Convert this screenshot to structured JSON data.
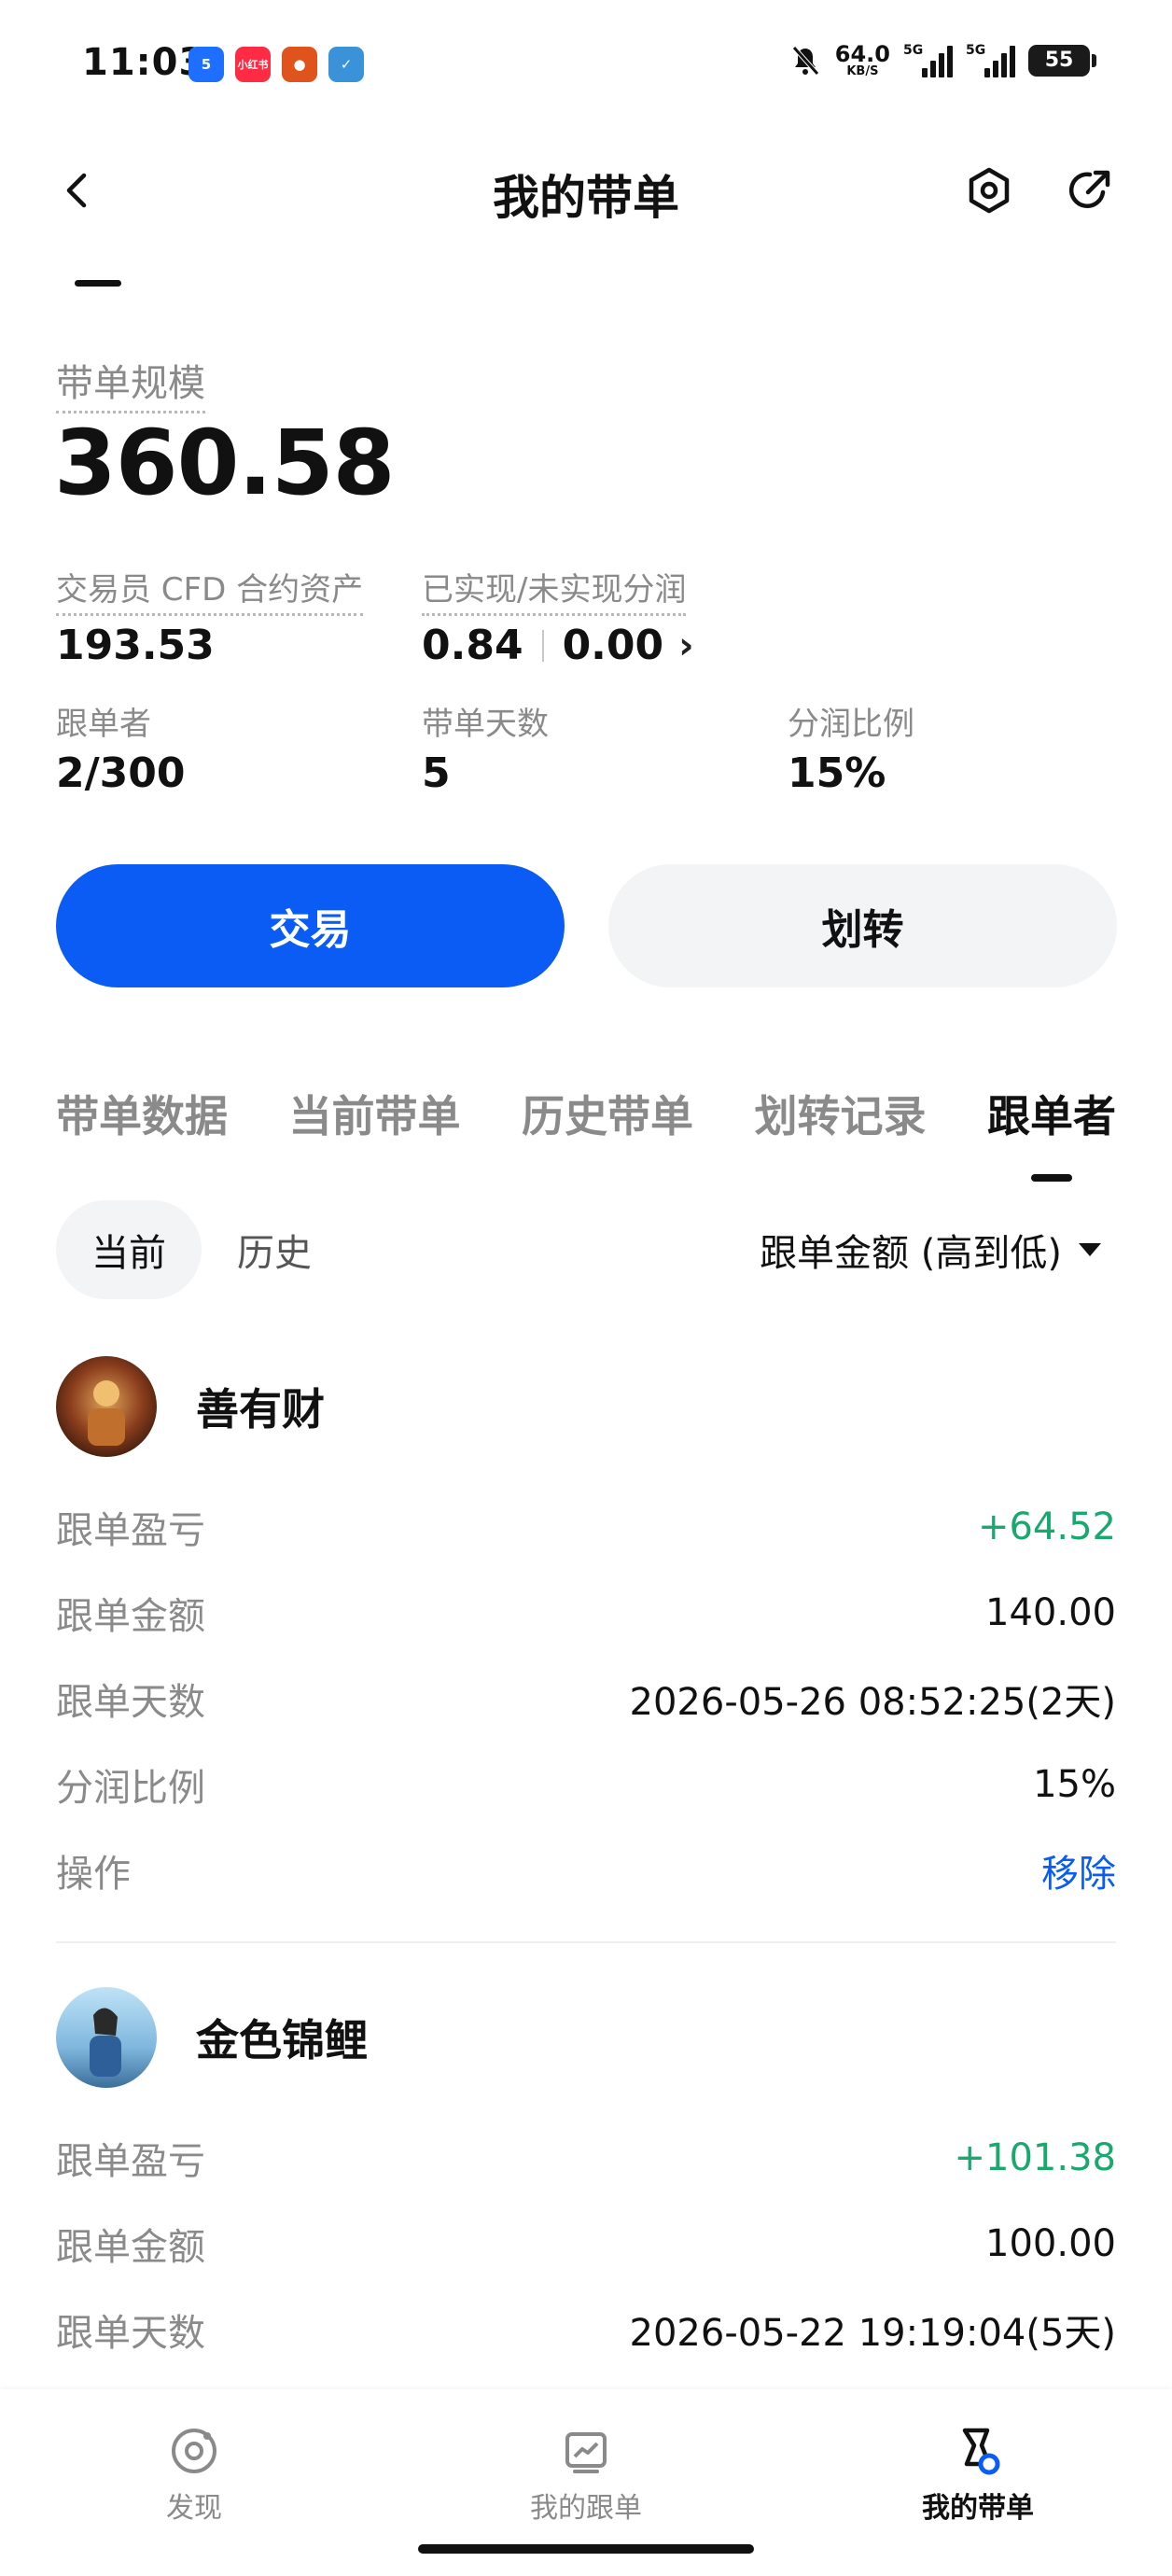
{
  "status": {
    "time": "11:03",
    "net_speed": "64.0",
    "net_unit": "KB/S",
    "sig1_label": "5G",
    "sig2_label": "5G",
    "battery": "55"
  },
  "header": {
    "title": "我的带单"
  },
  "summary": {
    "scale_label": "带单规模",
    "scale_value": "360.58",
    "cfd_label": "交易员 CFD 合约资产",
    "cfd_value": "193.53",
    "pnl_label": "已实现/未实现分润",
    "realized": "0.84",
    "unrealized": "0.00",
    "followers_label": "跟单者",
    "followers_value": "2/300",
    "days_label": "带单天数",
    "days_value": "5",
    "ratio_label": "分润比例",
    "ratio_value": "15%"
  },
  "actions": {
    "trade": "交易",
    "transfer": "划转"
  },
  "tabs": [
    {
      "label": "带单数据"
    },
    {
      "label": "当前带单"
    },
    {
      "label": "历史带单"
    },
    {
      "label": "划转记录"
    },
    {
      "label": "跟单者"
    }
  ],
  "filter": {
    "current": "当前",
    "history": "历史",
    "sort": "跟单金额 (高到低)"
  },
  "followers": [
    {
      "name": "善有财",
      "pnl_label": "跟单盈亏",
      "pnl": "+64.52",
      "amount_label": "跟单金额",
      "amount": "140.00",
      "days_label": "跟单天数",
      "days": "2026-05-26 08:52:25(2天)",
      "ratio_label": "分润比例",
      "ratio": "15%",
      "op_label": "操作",
      "op": "移除"
    },
    {
      "name": "金色锦鲤",
      "pnl_label": "跟单盈亏",
      "pnl": "+101.38",
      "amount_label": "跟单金额",
      "amount": "100.00",
      "days_label": "跟单天数",
      "days": "2026-05-22 19:19:04(5天)"
    }
  ],
  "nav": {
    "discover": "发现",
    "my_follow": "我的跟单",
    "my_lead": "我的带单"
  },
  "colors": {
    "primary": "#0a5cf5",
    "positive": "#1aa86e",
    "muted": "#8a8a8a"
  }
}
